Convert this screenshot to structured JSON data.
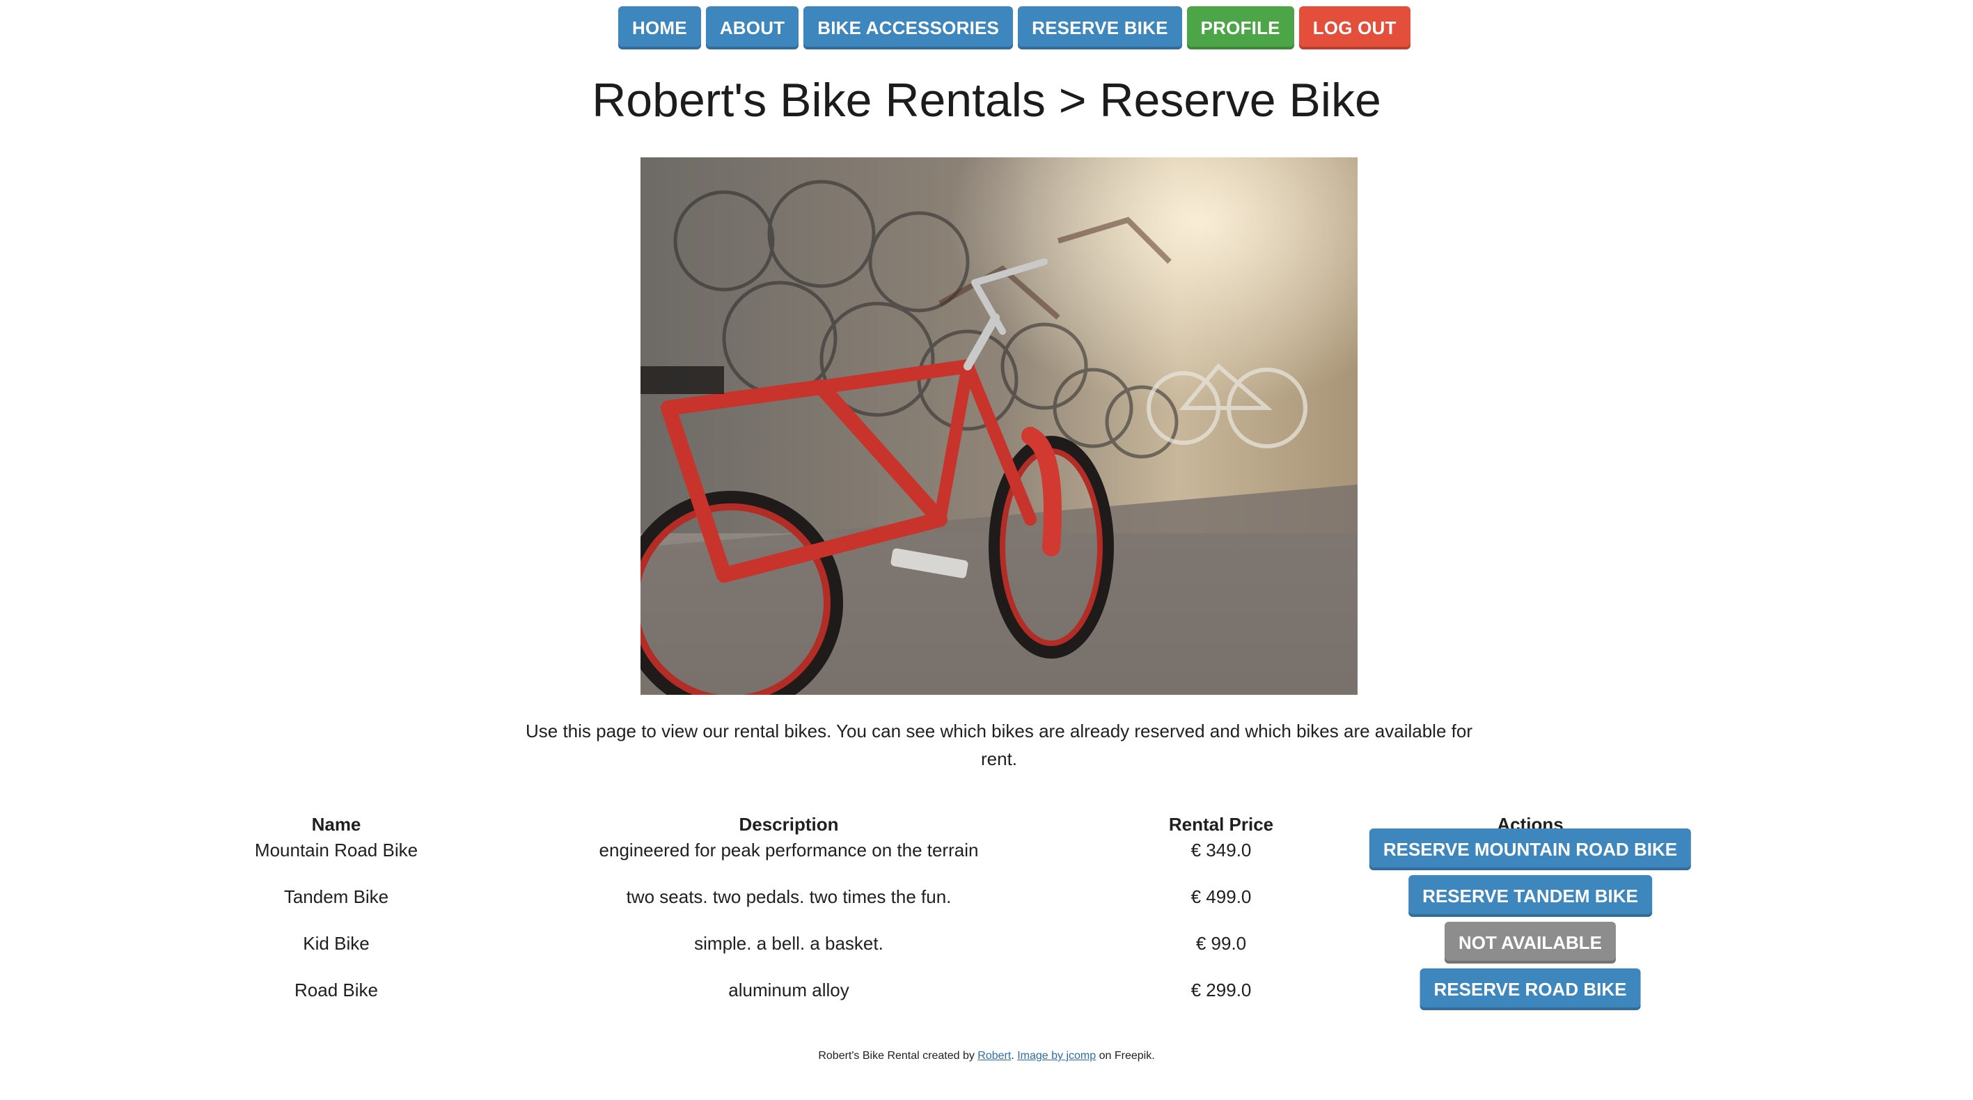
{
  "nav": {
    "items": [
      {
        "label": "HOME",
        "color": "#3d86be"
      },
      {
        "label": "ABOUT",
        "color": "#3d86be"
      },
      {
        "label": "BIKE ACCESSORIES",
        "color": "#3d86be"
      },
      {
        "label": "RESERVE BIKE",
        "color": "#3d86be"
      },
      {
        "label": "PROFILE",
        "color": "#4ca647"
      },
      {
        "label": "LOG OUT",
        "color": "#e44f3c"
      }
    ]
  },
  "page": {
    "title": "Robert's Bike Rentals > Reserve Bike",
    "intro": "Use this page to view our rental bikes. You can see which bikes are already reserved and which bikes are available for rent."
  },
  "hero": {
    "description_icon": "bike-shop-photo"
  },
  "table": {
    "headers": [
      "Name",
      "Description",
      "Rental Price",
      "Actions"
    ],
    "rows": [
      {
        "name": "Mountain Road Bike",
        "description": "engineered for peak performance on the terrain",
        "price": "€ 349.0",
        "action": "RESERVE MOUNTAIN ROAD BIKE",
        "available": true
      },
      {
        "name": "Tandem Bike",
        "description": "two seats. two pedals. two times the fun.",
        "price": "€ 499.0",
        "action": "RESERVE TANDEM BIKE",
        "available": true
      },
      {
        "name": "Kid Bike",
        "description": "simple. a bell. a basket.",
        "price": "€ 99.0",
        "action": "NOT AVAILABLE",
        "available": false
      },
      {
        "name": "Road Bike",
        "description": "aluminum alloy",
        "price": "€ 299.0",
        "action": "RESERVE ROAD BIKE",
        "available": true
      }
    ]
  },
  "footer": {
    "prefix": "Robert's Bike Rental created by ",
    "author_link": "Robert",
    "separator": ". ",
    "image_link": "Image by jcomp",
    "suffix": " on Freepik."
  },
  "colors": {
    "primary": "#3d86be",
    "success": "#4ca647",
    "danger": "#e44f3c",
    "disabled": "#8d8d8d"
  }
}
